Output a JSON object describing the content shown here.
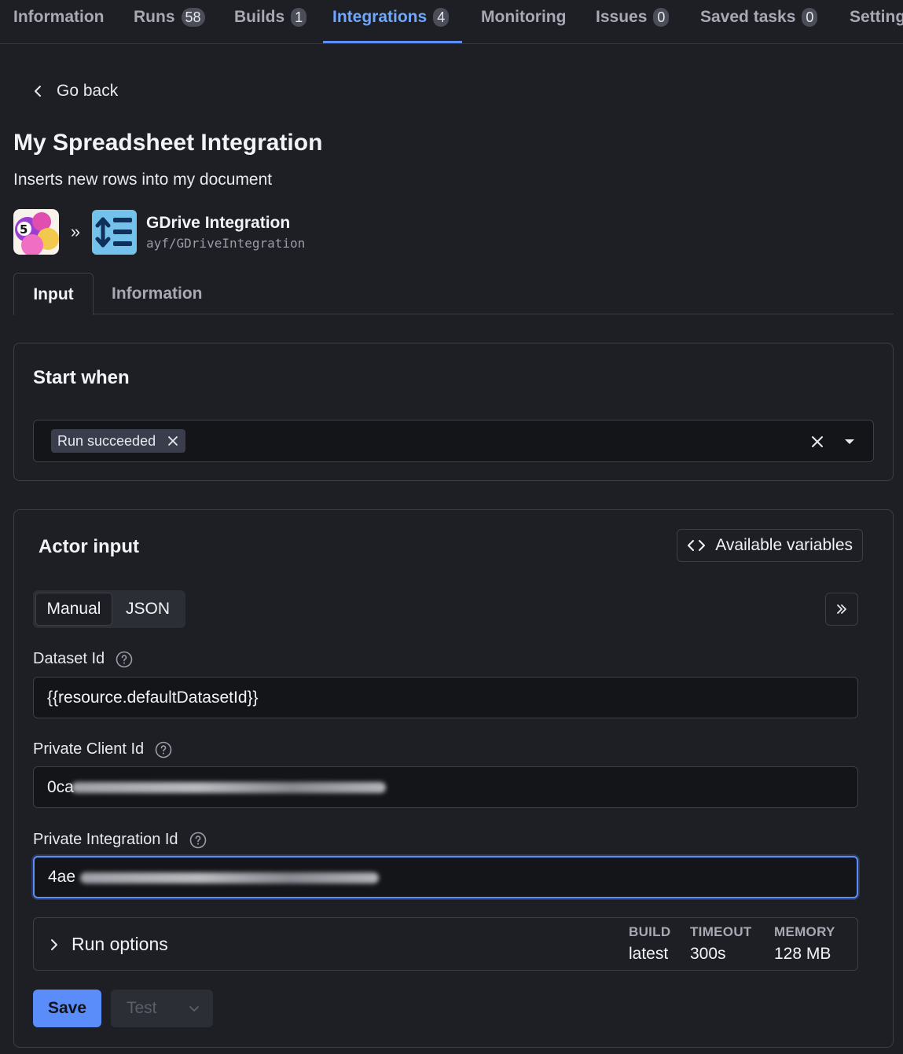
{
  "top_tabs": [
    {
      "label": "Information",
      "count": null
    },
    {
      "label": "Runs",
      "count": "58"
    },
    {
      "label": "Builds",
      "count": "1"
    },
    {
      "label": "Integrations",
      "count": "4",
      "active": true
    },
    {
      "label": "Monitoring",
      "count": null
    },
    {
      "label": "Issues",
      "count": "0"
    },
    {
      "label": "Saved tasks",
      "count": "0"
    },
    {
      "label": "Setting",
      "count": null
    }
  ],
  "go_back": "Go back",
  "integration": {
    "title": "My Spreadsheet Integration",
    "description": "Inserts new rows into my document"
  },
  "actor": {
    "separator": "»",
    "name": "GDrive Integration",
    "slug": "ayf/GDriveIntegration"
  },
  "inner_tabs": {
    "input": "Input",
    "information": "Information"
  },
  "start_when": {
    "title": "Start when",
    "selected_chip": "Run succeeded"
  },
  "actor_input": {
    "title": "Actor input",
    "available_variables": "Available variables",
    "mode_manual": "Manual",
    "mode_json": "JSON",
    "fields": {
      "dataset_id": {
        "label": "Dataset Id",
        "value": "{{resource.defaultDatasetId}}"
      },
      "private_client_id": {
        "label": "Private Client Id",
        "value": "0ca"
      },
      "private_integration_id": {
        "label": "Private Integration Id",
        "value": "4ae"
      }
    },
    "run_options": {
      "label": "Run options",
      "build_key": "BUILD",
      "build_val": "latest",
      "timeout_key": "TIMEOUT",
      "timeout_val": "300s",
      "memory_key": "MEMORY",
      "memory_val": "128 MB"
    },
    "save": "Save",
    "test": "Test"
  },
  "colors": {
    "accent": "#5a8dfa",
    "background": "#1e1f24",
    "input_bg": "#141519"
  }
}
